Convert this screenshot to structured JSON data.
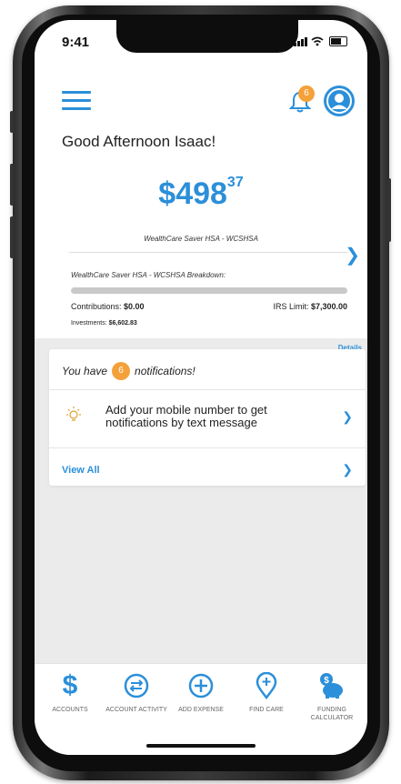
{
  "status": {
    "time": "9:41"
  },
  "header": {
    "notification_count": "6",
    "greeting": "Good Afternoon Isaac!"
  },
  "account": {
    "balance_dollars": "$498",
    "balance_cents": "37",
    "name": "WealthCare Saver HSA - WCSHSA",
    "breakdown_title": "WealthCare Saver HSA - WCSHSA Breakdown:",
    "contributions_label": "Contributions: ",
    "contributions_value": "$0.00",
    "irs_limit_label": "IRS Limit: ",
    "irs_limit_value": "$7,300.00",
    "investments_label": "Investments: ",
    "investments_value": "$6,602.83",
    "details_label": "Details"
  },
  "notifications": {
    "prefix": "You have",
    "count": "6",
    "suffix": "notifications!",
    "item_text": "Add your mobile number to get notifications by text message",
    "view_all_label": "View All"
  },
  "nav": {
    "items": [
      {
        "label": "ACCOUNTS",
        "icon": "dollar-icon"
      },
      {
        "label": "ACCOUNT ACTIVITY",
        "icon": "activity-icon"
      },
      {
        "label": "ADD EXPENSE",
        "icon": "plus-circle-icon"
      },
      {
        "label": "FIND CARE",
        "icon": "map-pin-plus-icon"
      },
      {
        "label": "FUNDING CALCULATOR",
        "icon": "piggy-bank-icon"
      }
    ]
  },
  "colors": {
    "accent": "#2b8fd9",
    "badge": "#f4a13a",
    "background": "#ebebeb"
  }
}
